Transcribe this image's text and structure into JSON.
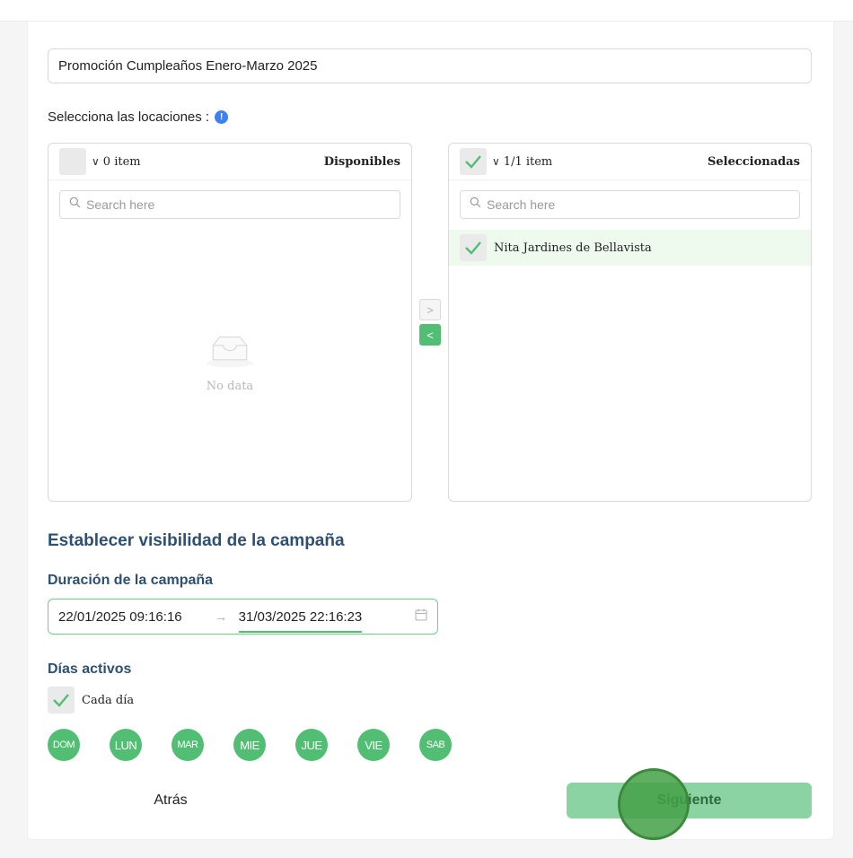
{
  "form": {
    "campaign_name_value": "Promoción Cumpleaños Enero-Marzo 2025"
  },
  "locations": {
    "label": "Selecciona las locaciones :",
    "info_icon": "info-icon",
    "available": {
      "title": "Disponibles",
      "count": "0 item",
      "search_placeholder": "Search here",
      "empty_text": "No data",
      "items": []
    },
    "selected": {
      "title": "Seleccionadas",
      "count": "1/1 item",
      "search_placeholder": "Search here",
      "items": [
        {
          "label": "Nita Jardines de Bellavista",
          "checked": true
        }
      ]
    },
    "move_right_icon": ">",
    "move_left_icon": "<"
  },
  "visibility": {
    "section_title": "Establecer visibilidad de la campaña",
    "duration_label": "Duración de la campaña",
    "start_date": "22/01/2025 09:16:16",
    "range_separator": "→",
    "end_date": "31/03/2025 22:16:23",
    "active_days_label": "Días activos",
    "every_day_label": "Cada día",
    "every_day_checked": true,
    "days": [
      "DOM",
      "LUN",
      "MAR",
      "MIE",
      "JUE",
      "VIE",
      "SAB"
    ]
  },
  "actions": {
    "back_label": "Atrás",
    "next_label": "Siguiente"
  },
  "colors": {
    "accent_green": "#52be73",
    "next_button_bg": "#8bd3a2",
    "heading_blue": "#2d5072",
    "info_blue": "#3b82f6"
  }
}
